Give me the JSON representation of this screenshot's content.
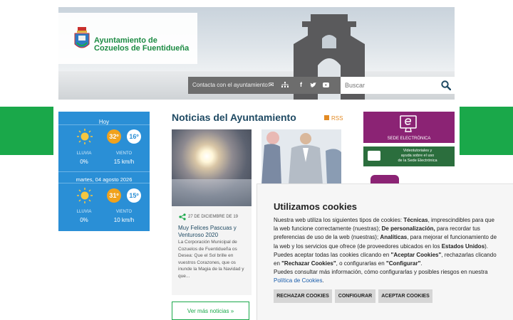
{
  "header": {
    "org_line1": "Ayuntamiento de",
    "org_line2": "Cozuelos de Fuentidueña",
    "contact_label": "Contacta con el ayuntamiento:",
    "search_placeholder": "Buscar"
  },
  "weather": {
    "today": {
      "label": "Hoy",
      "max": "32º",
      "min": "16º",
      "rain_label": "LLUVIA",
      "rain": "0%",
      "wind_label": "VIENTO",
      "wind": "15 km/h"
    },
    "tomorrow": {
      "label": "martes, 04 agosto 2026",
      "max": "31º",
      "min": "15º",
      "rain_label": "LLUVIA",
      "rain": "0%",
      "wind_label": "VIENTO",
      "wind": "10 km/h"
    }
  },
  "news": {
    "title": "Noticias del Ayuntamiento",
    "rss": "RSS",
    "item": {
      "date": "27 DE DICIEMBRE DE 19",
      "headline": "Muy Felices Pascuas y Venturoso 2020",
      "body": "La Corporación Municipal de Cozuelos de Fuentidueña os Desea: Que el Sol brille en vuestros Corazones, que os inunde la Magia de la Navidad y que..."
    },
    "more": "Ver más noticias  »"
  },
  "sidebar": {
    "sede": "SEDE ELECTRÓNICA",
    "video_line1": "Videotutoriales y",
    "video_line2": "ayuda sobre el uso",
    "video_line3": "de la Sede Electrónica"
  },
  "cookies": {
    "title": "Utilizamos cookies",
    "p1a": "Nuestra web utiliza los siguientes tipos de cookies: ",
    "p1b": "Técnicas",
    "p1c": ", imprescindibles para que la web funcione correctamente (nuestras); ",
    "p1d": "De personalización,",
    "p1e": " para recordar tus preferencias de uso de la web (nuestras); ",
    "p1f": "Analíticas",
    "p1g": ", para mejorar el funcionamiento de la web y los servicios que ofrece (de proveedores ubicados en los ",
    "p1h": "Estados Unidos",
    "p1i": ").",
    "p2a": "Puedes aceptar todas las cookies clicando en ",
    "p2b": "\"Aceptar Cookies\"",
    "p2c": ", rechazarlas clicando en ",
    "p2d": "\"Rechazar Cookies\"",
    "p2e": ", o configurarlas en ",
    "p2f": "\"Configurar\"",
    "p2g": ".",
    "p3": "Puedes consultar más información, cómo configurarlas y posibles riesgos en nuestra",
    "policy_link": "Política de Cookies",
    "period": ".",
    "btn_reject": "RECHAZAR COOKIES",
    "btn_config": "CONFIGURAR",
    "btn_accept": "ACEPTAR COOKIES"
  },
  "colors": {
    "brand_green": "#1aa84a",
    "weather_blue": "#2a8fd6",
    "sede_purple": "#8b2374"
  }
}
